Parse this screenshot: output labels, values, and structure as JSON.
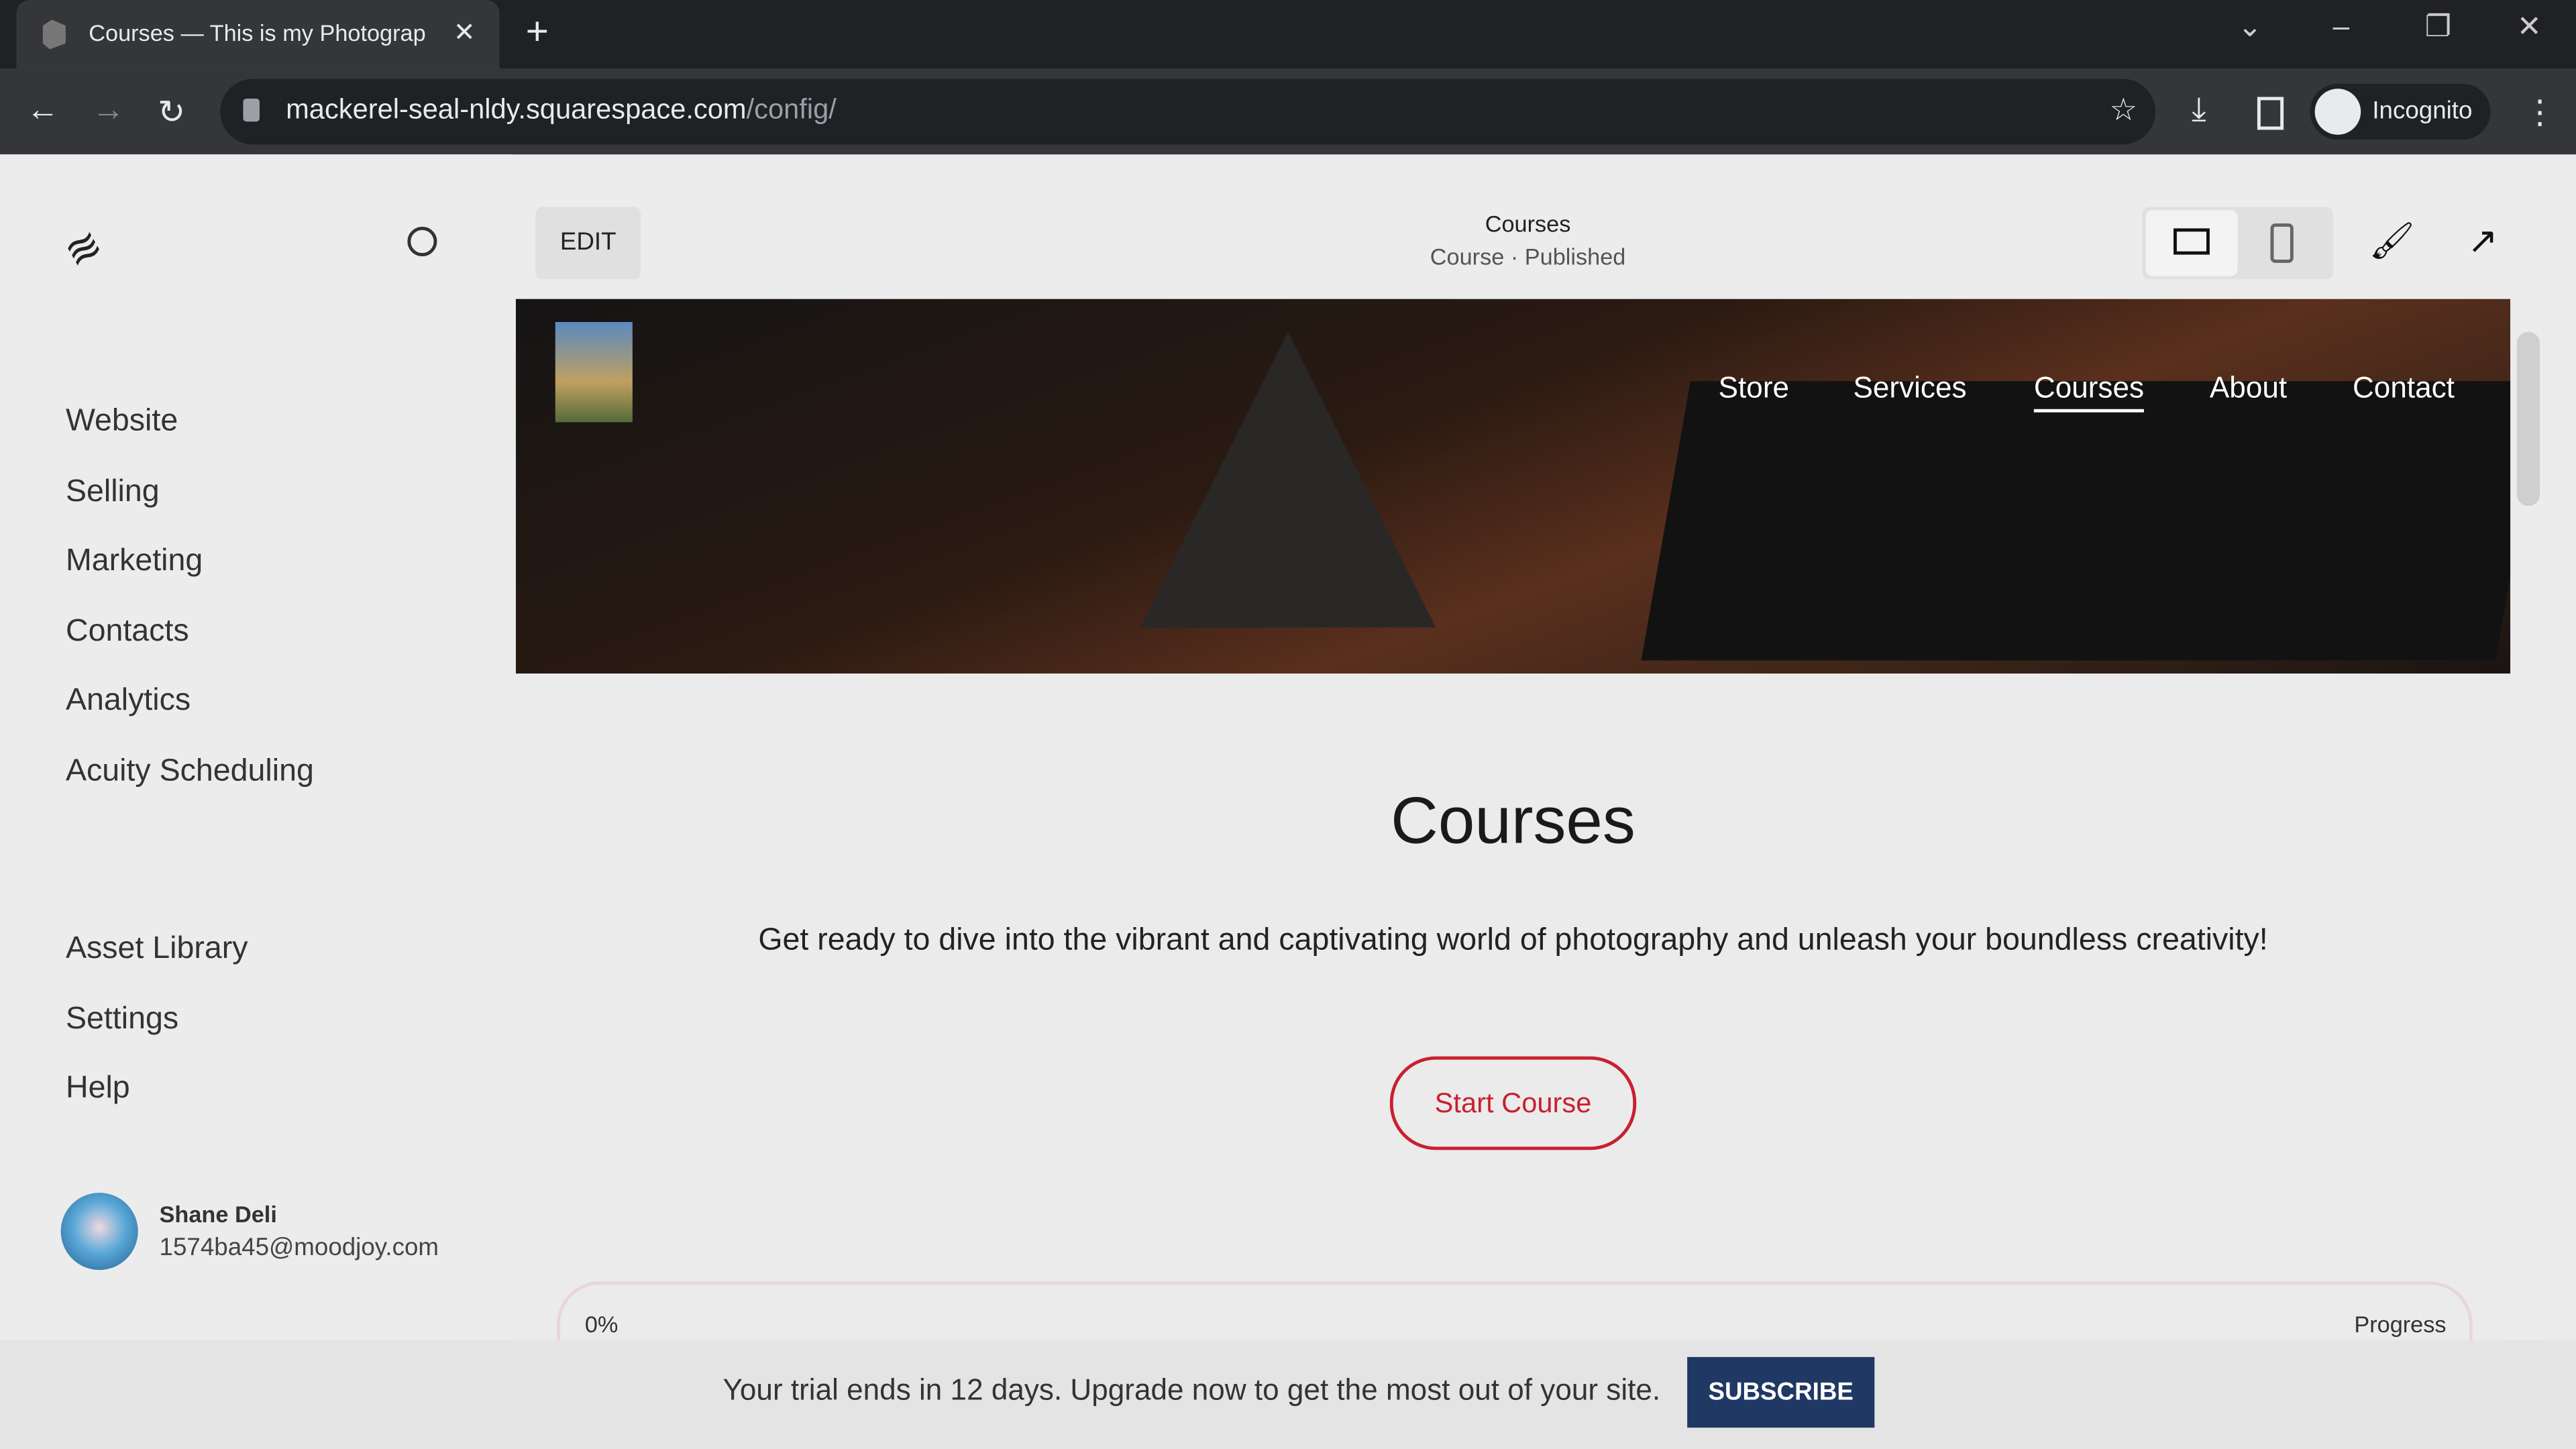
{
  "browser": {
    "tab_title": "Courses — This is my Photograp",
    "url_host": "mackerel-seal-nldy.squarespace.com",
    "url_path": "/config/",
    "profile": "Incognito"
  },
  "sidebar": {
    "items": [
      {
        "label": "Website"
      },
      {
        "label": "Selling"
      },
      {
        "label": "Marketing"
      },
      {
        "label": "Contacts"
      },
      {
        "label": "Analytics"
      },
      {
        "label": "Acuity Scheduling"
      }
    ],
    "secondary": [
      {
        "label": "Asset Library"
      },
      {
        "label": "Settings"
      },
      {
        "label": "Help"
      }
    ],
    "user": {
      "name": "Shane Deli",
      "email": "1574ba45@moodjoy.com"
    }
  },
  "editor": {
    "edit_label": "EDIT",
    "page_title": "Courses",
    "page_status": "Course · Published"
  },
  "site": {
    "nav": [
      "Store",
      "Services",
      "Courses",
      "About",
      "Contact"
    ],
    "active_nav": "Courses",
    "heading": "Courses",
    "description": "Get ready to dive into the vibrant and captivating world of photography and unleash your boundless creativity!",
    "cta": "Start Course",
    "progress_value": "0%",
    "progress_label": "Progress",
    "progress": 0,
    "accent": "#c8202f"
  },
  "banner": {
    "text": "Your trial ends in 12 days. Upgrade now to get the most out of your site.",
    "button": "SUBSCRIBE",
    "button_color": "#1f3864"
  }
}
